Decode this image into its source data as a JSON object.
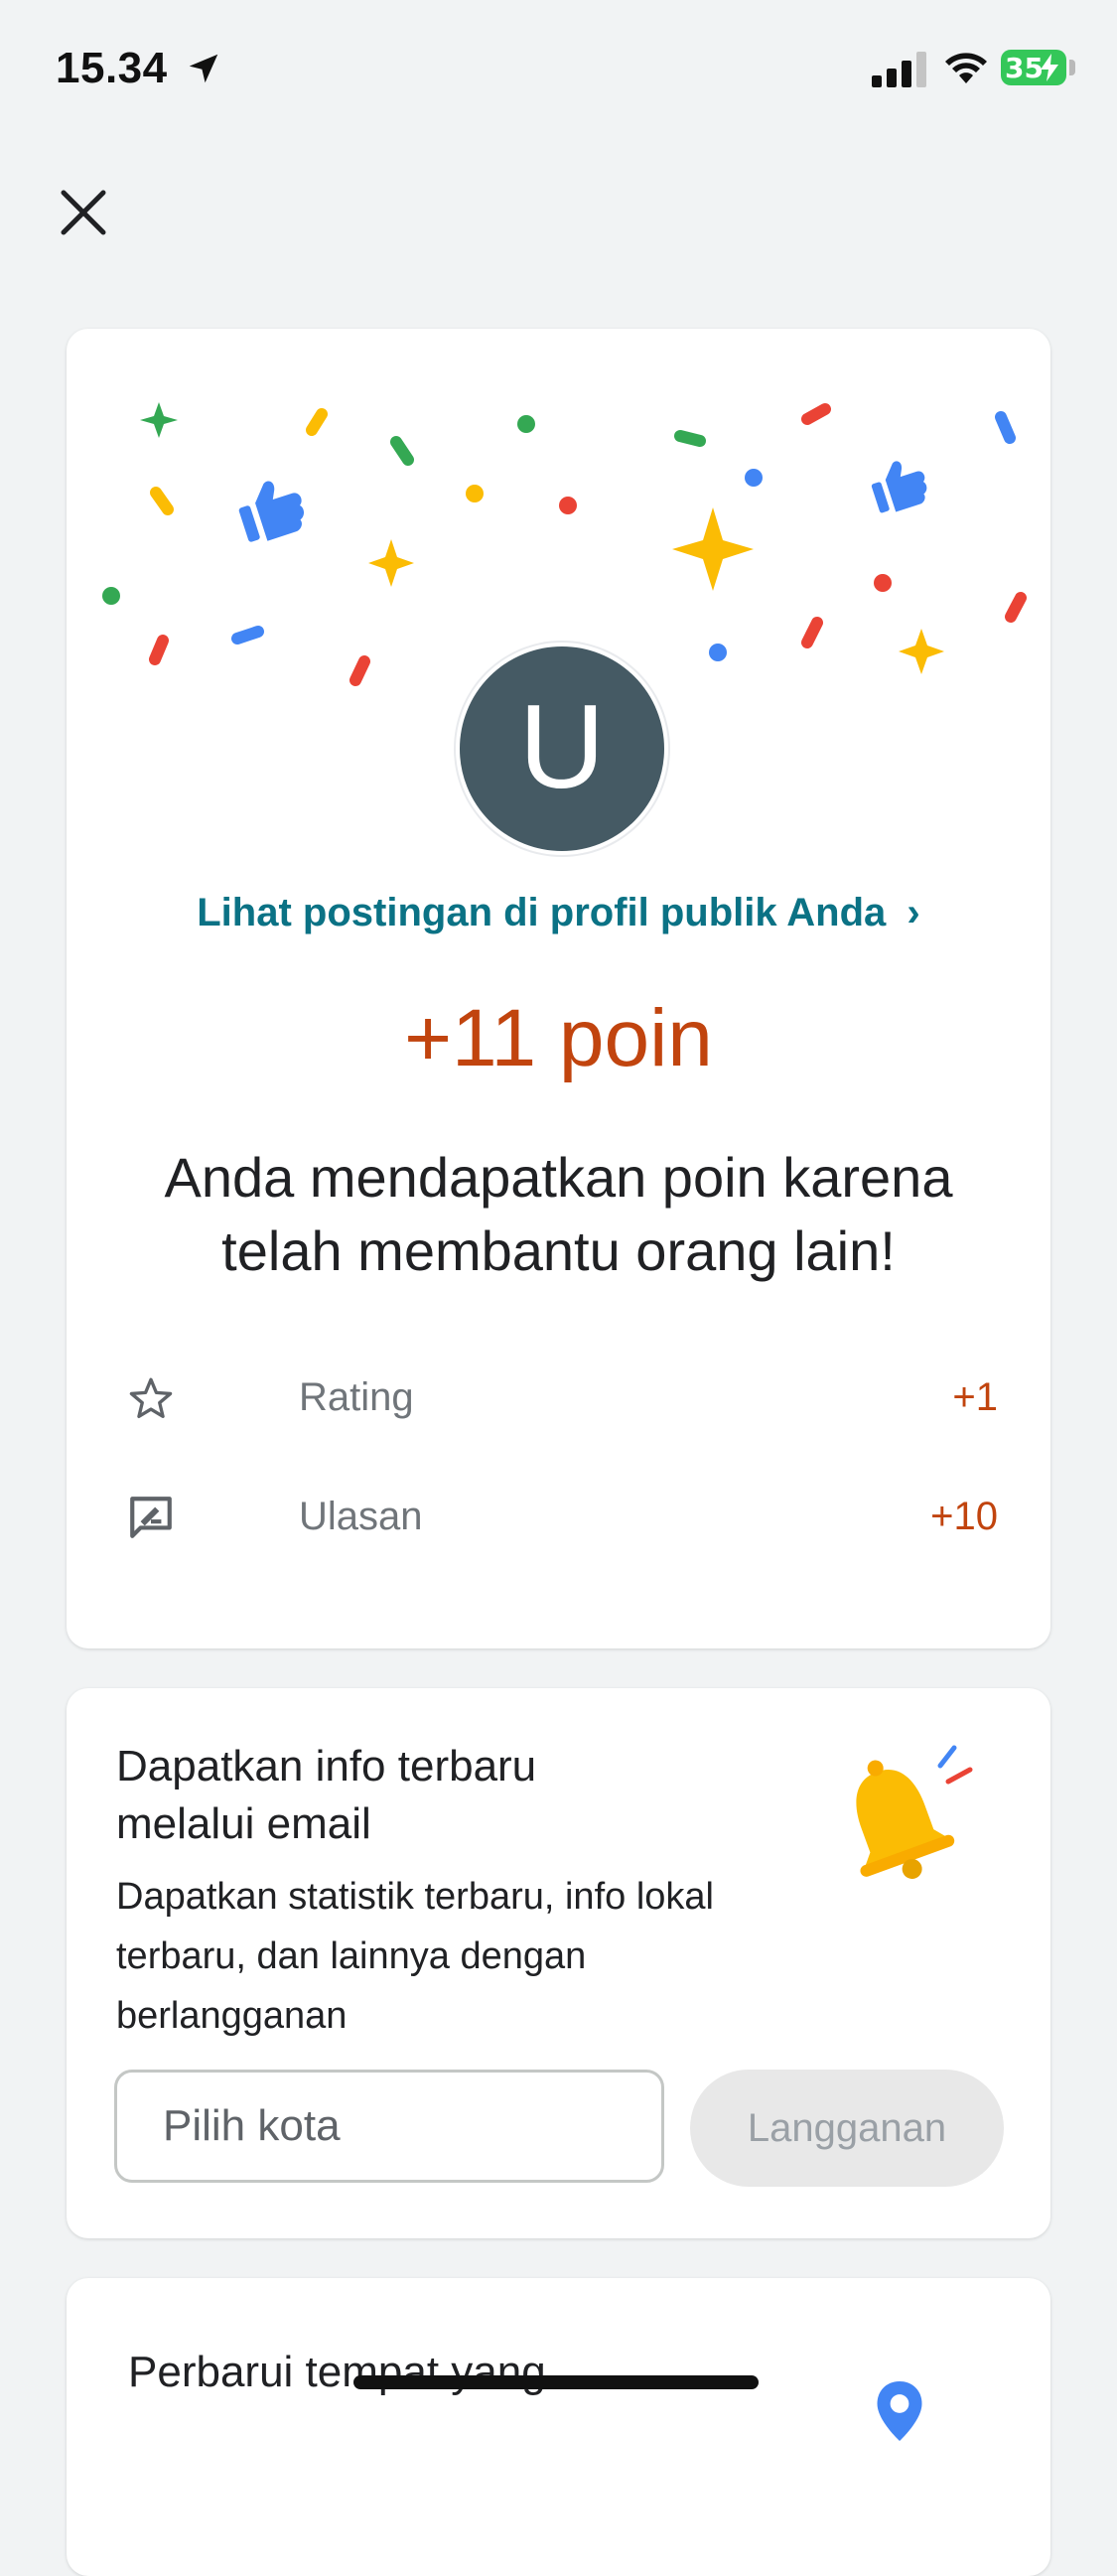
{
  "status_bar": {
    "time": "15.34",
    "battery_level": "35"
  },
  "header": {
    "close_icon": "close-icon"
  },
  "card1": {
    "avatar_letter": "U",
    "profile_link": "Lihat postingan di profil publik Anda",
    "points": "+11 poin",
    "message": "Anda mendapatkan poin karena telah membantu orang lain!",
    "rows": [
      {
        "icon": "star-outline-icon",
        "label": "Rating",
        "value": "+1"
      },
      {
        "icon": "review-icon",
        "label": "Ulasan",
        "value": "+10"
      }
    ]
  },
  "card2": {
    "title": "Dapatkan info terbaru melalui email",
    "body": "Dapatkan statistik terbaru, info lokal terbaru, dan lainnya dengan berlangganan",
    "city_placeholder": "Pilih kota",
    "subscribe_label": "Langganan"
  },
  "card3": {
    "title": "Perbarui tempat yang"
  },
  "colors": {
    "accent_orange": "#c1440e",
    "link_teal": "#0b7285",
    "avatar_bg": "#455a64",
    "battery_green": "#34c759"
  }
}
